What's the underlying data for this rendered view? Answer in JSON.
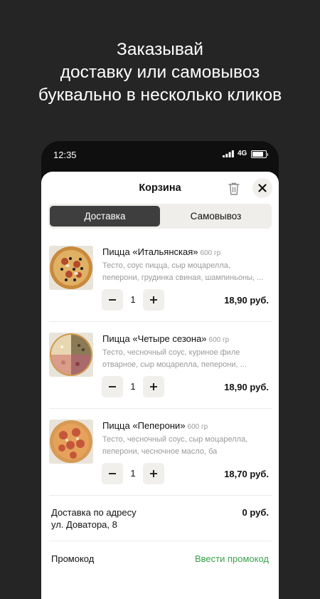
{
  "headline": [
    "Заказывай",
    "доставку или самовывоз",
    "буквально в несколько кликов"
  ],
  "status_bar": {
    "time": "12:35",
    "network": "4G"
  },
  "cart": {
    "title": "Корзина",
    "tabs": [
      {
        "label": "Доставка",
        "active": true
      },
      {
        "label": "Самовывоз",
        "active": false
      }
    ],
    "items": [
      {
        "name": "Пицца «Итальянская»",
        "weight": "600 гр",
        "desc": [
          "Тесто, соус пицца, сыр моцарелла,",
          "пеперони, грудинка свиная, шампиньоны, ..."
        ],
        "qty": "1",
        "price": "18,90 руб."
      },
      {
        "name": "Пицца «Четыре сезона»",
        "weight": "600 гр",
        "desc": [
          "Тесто, чесночный соус, куриное филе",
          "отварное, сыр моцарелла, пеперони, ..."
        ],
        "qty": "1",
        "price": "18,90 руб."
      },
      {
        "name": "Пицца «Пеперони»",
        "weight": "600 гр",
        "desc": [
          "Тесто, чесночный соус, сыр моцарелла,",
          "пеперони, чесночное масло, ба"
        ],
        "qty": "1",
        "price": "18,70 руб."
      }
    ],
    "delivery": {
      "label_line1": "Доставка по адресу",
      "label_line2": "ул. Доватора, 8",
      "price": "0 руб."
    },
    "promo": {
      "label": "Промокод",
      "link": "Ввести промокод"
    }
  },
  "colors": {
    "background": "#262526",
    "accent_green": "#3aa14a",
    "active_tab": "#3e3e3e"
  }
}
